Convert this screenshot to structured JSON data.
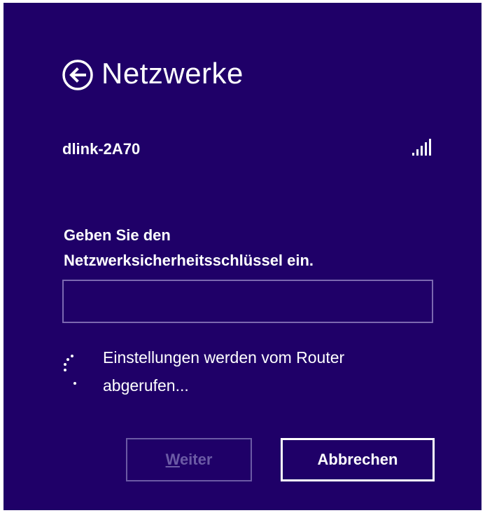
{
  "panel": {
    "title": "Netzwerke",
    "back_icon": "back-arrow-circle-icon"
  },
  "network": {
    "ssid": "dlink-2A70",
    "signal_icon": "wifi-signal-bars-icon",
    "signal_strength_bars": 5
  },
  "security_key": {
    "prompt_line1": "Geben Sie den",
    "prompt_line2": "Netzwerksicherheitsschlüssel ein.",
    "value": "",
    "placeholder": ""
  },
  "status": {
    "spinner_icon": "loading-spinner-icon",
    "line1": "Einstellungen werden vom Router",
    "line2": "abgerufen..."
  },
  "buttons": {
    "next_accel": "W",
    "next_rest": "eiter",
    "cancel_label": "Abbrechen"
  },
  "colors": {
    "background": "#1f0068",
    "text": "#ffffff",
    "input_border": "#7b68b0",
    "disabled": "#6b5aa5"
  }
}
